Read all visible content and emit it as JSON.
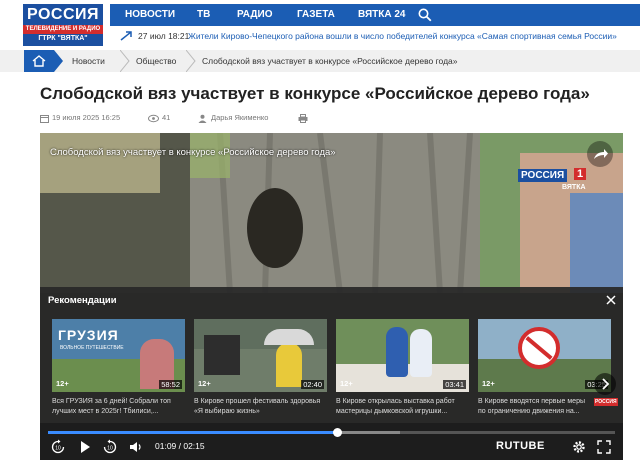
{
  "header": {
    "logo_main": "РОССИЯ",
    "logo_sub1": "ТЕЛЕВИДЕНИЕ И РАДИО",
    "logo_sub2": "ГТРК \"ВЯТКА\"",
    "nav": [
      "НОВОСТИ",
      "ТВ",
      "РАДИО",
      "ГАЗЕТА",
      "ВЯТКА 24"
    ],
    "ticker_time": "27 июл 18:21",
    "ticker_text": "Жители Кирово-Чепецкого района вошли в число победителей конкурса «Самая спортивная семья России»"
  },
  "breadcrumbs": [
    "Новости",
    "Общество",
    "Слободской вяз участвует в конкурсе «Российское дерево года»"
  ],
  "article": {
    "title": "Слободской вяз участвует в конкурсе «Российское дерево года»",
    "date": "19 июля 2025 16:25",
    "views": "41",
    "author": "Дарья Якименко"
  },
  "player": {
    "video_title": "Слободской вяз участвует в конкурсе «Российское дерево года»",
    "channel": "РОССИЯ",
    "channel_number": "1",
    "channel_region": "ВЯТКА",
    "recommendations_title": "Рекомендации",
    "recommendations": [
      {
        "title": "Вся ГРУЗИЯ за 6 дней! Собрали топ лучших мест в 2025г! Тбилиси,...",
        "age": "12+",
        "duration": "58:52",
        "thumb_text": "ГРУЗИЯ",
        "thumb_subtext": "ВОЛЬНОЕ ПУТЕШЕСТВИЕ"
      },
      {
        "title": "В Кирове прошел фестиваль здоровья «Я выбираю жизнь»",
        "age": "12+",
        "duration": "02:40"
      },
      {
        "title": "В Кирове открылась выставка работ мастерицы дымковской игрушки...",
        "age": "12+",
        "duration": "03:41"
      },
      {
        "title": "В Кирове вводятся первые меры по ограничению движения на...",
        "age": "12+",
        "duration": "03:25",
        "channel": "РОССИЯ"
      }
    ],
    "time_current": "01:09",
    "time_total": "02:15",
    "time_display": "01:09 / 02:15",
    "progress": 0.51,
    "buffered": 0.62,
    "brand": "RUTUBE",
    "colors": {
      "nav": "#1b5db4",
      "logo": "#1b4fa0",
      "accent_red": "#d32d2d",
      "progress": "#3a8cff"
    }
  }
}
